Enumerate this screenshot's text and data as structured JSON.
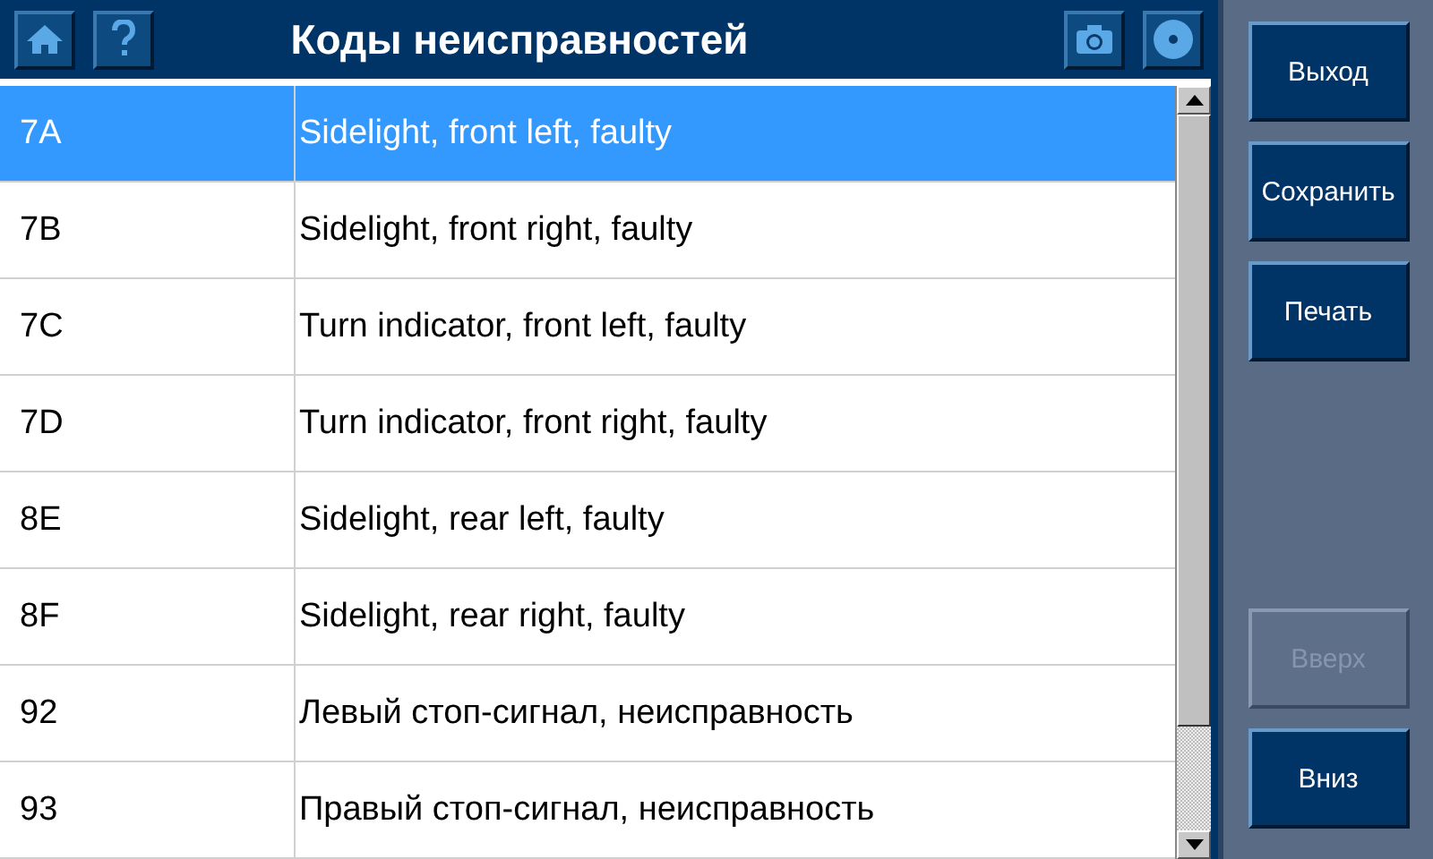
{
  "header": {
    "title": "Коды неисправностей"
  },
  "faults": [
    {
      "code": "7A",
      "description": "Sidelight, front left, faulty",
      "selected": true
    },
    {
      "code": "7B",
      "description": "Sidelight, front right, faulty",
      "selected": false
    },
    {
      "code": "7C",
      "description": "Turn indicator, front left, faulty",
      "selected": false
    },
    {
      "code": "7D",
      "description": "Turn indicator, front right, faulty",
      "selected": false
    },
    {
      "code": "8E",
      "description": "Sidelight, rear left, faulty",
      "selected": false
    },
    {
      "code": "8F",
      "description": "Sidelight, rear right, faulty",
      "selected": false
    },
    {
      "code": "92",
      "description": "Левый стоп-сигнал, неисправность",
      "selected": false
    },
    {
      "code": "93",
      "description": "Правый стоп-сигнал, неисправность",
      "selected": false
    }
  ],
  "top_buttons": [
    {
      "label": "Выход",
      "disabled": false
    },
    {
      "label": "Сохранить",
      "disabled": false
    },
    {
      "label": "Печать",
      "disabled": false
    }
  ],
  "bottom_buttons": [
    {
      "label": "Вверх",
      "disabled": true
    },
    {
      "label": "Вниз",
      "disabled": false
    }
  ]
}
